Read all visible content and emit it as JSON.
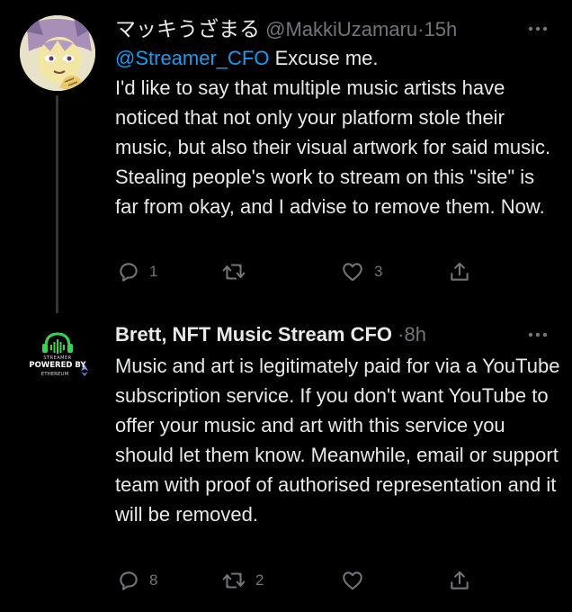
{
  "tweets": [
    {
      "display_name": "マッキうざまる",
      "handle": "@MakkiUzamaru",
      "separator": "·",
      "time": "15h",
      "mention": "@Streamer_CFO",
      "text_after_mention": " Excuse me.\nI'd like to say that multiple music artists have noticed that not only your platform stole their music, but also their visual artwork for said music. Stealing people's work to stream on this \"site\" is far from okay, and I advise to remove them. Now.",
      "replies": "1",
      "retweets": "",
      "likes": "3",
      "avatar_icon": "anime-character-avatar"
    },
    {
      "display_name": "Brett, NFT Music Stream CFO",
      "handle": "",
      "separator": "·",
      "time": "8h",
      "text": "Music and art is legitimately paid for via a YouTube subscription service. If you don't want YouTube to offer your music and art with this service you should let them know. Meanwhile, email or support team with proof of authorised representation and it will be removed.",
      "replies": "8",
      "retweets": "2",
      "likes": "",
      "avatar_icon": "streamer-logo-avatar",
      "avatar_text": {
        "top": "STREAMER",
        "main": "POWERED BY",
        "bottom": "ETHEREUM"
      }
    }
  ],
  "colors": {
    "background": "#000000",
    "text": "#e7e9ea",
    "muted": "#71767b",
    "link": "#1d9bf0",
    "thread_line": "#333639",
    "logo_green": "#39d353"
  }
}
